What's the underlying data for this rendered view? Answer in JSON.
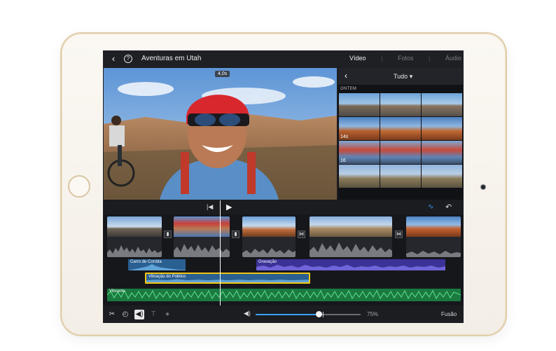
{
  "header": {
    "back_icon": "chevron-left-icon",
    "help_icon": "question-circle-icon",
    "project_title": "Aventuras em Utah",
    "tabs": [
      {
        "label": "Vídeo",
        "active": true
      },
      {
        "label": "Fotos",
        "active": false
      },
      {
        "label": "Áudio",
        "active": false
      }
    ]
  },
  "viewer": {
    "timecode": "4,0s"
  },
  "browser": {
    "back_icon": "chevron-left-icon",
    "filter_label": "Tudo",
    "filter_icon": "triangle-down-icon",
    "section_label": "ONTEM",
    "row_durations": [
      "",
      "14s",
      "16",
      ""
    ]
  },
  "timeline": {
    "skip_icon": "skip-to-start-icon",
    "play_icon": "play-icon",
    "audio_wave_icon": "waveform-icon",
    "undo_icon": "undo-icon",
    "transition_icons": [
      "bar-transition-icon",
      "bar-transition-icon",
      "bowtie-transition-icon",
      "bowtie-transition-icon"
    ],
    "audio_tracks": [
      {
        "label": "Carro de Corrida",
        "color": "#2f6ea6"
      },
      {
        "label": "Gravação",
        "color": "#4a3fb0"
      },
      {
        "label": "Vibração do Público",
        "color": "#2f6ea6",
        "selected_color": "#f2c512"
      },
      {
        "label": "Vibrante",
        "color": "#1f8a4a"
      }
    ]
  },
  "toolbar": {
    "tools": [
      {
        "icon": "scissors-icon",
        "active": false
      },
      {
        "icon": "speedometer-icon",
        "active": false
      },
      {
        "icon": "speaker-icon",
        "active": true
      },
      {
        "icon": "text-icon",
        "active": false
      },
      {
        "icon": "filter-icon",
        "active": false
      }
    ],
    "volume_icon": "speaker-icon",
    "volume_value": 0.6,
    "volume_label": "75%",
    "fade_label": "Fusão"
  }
}
